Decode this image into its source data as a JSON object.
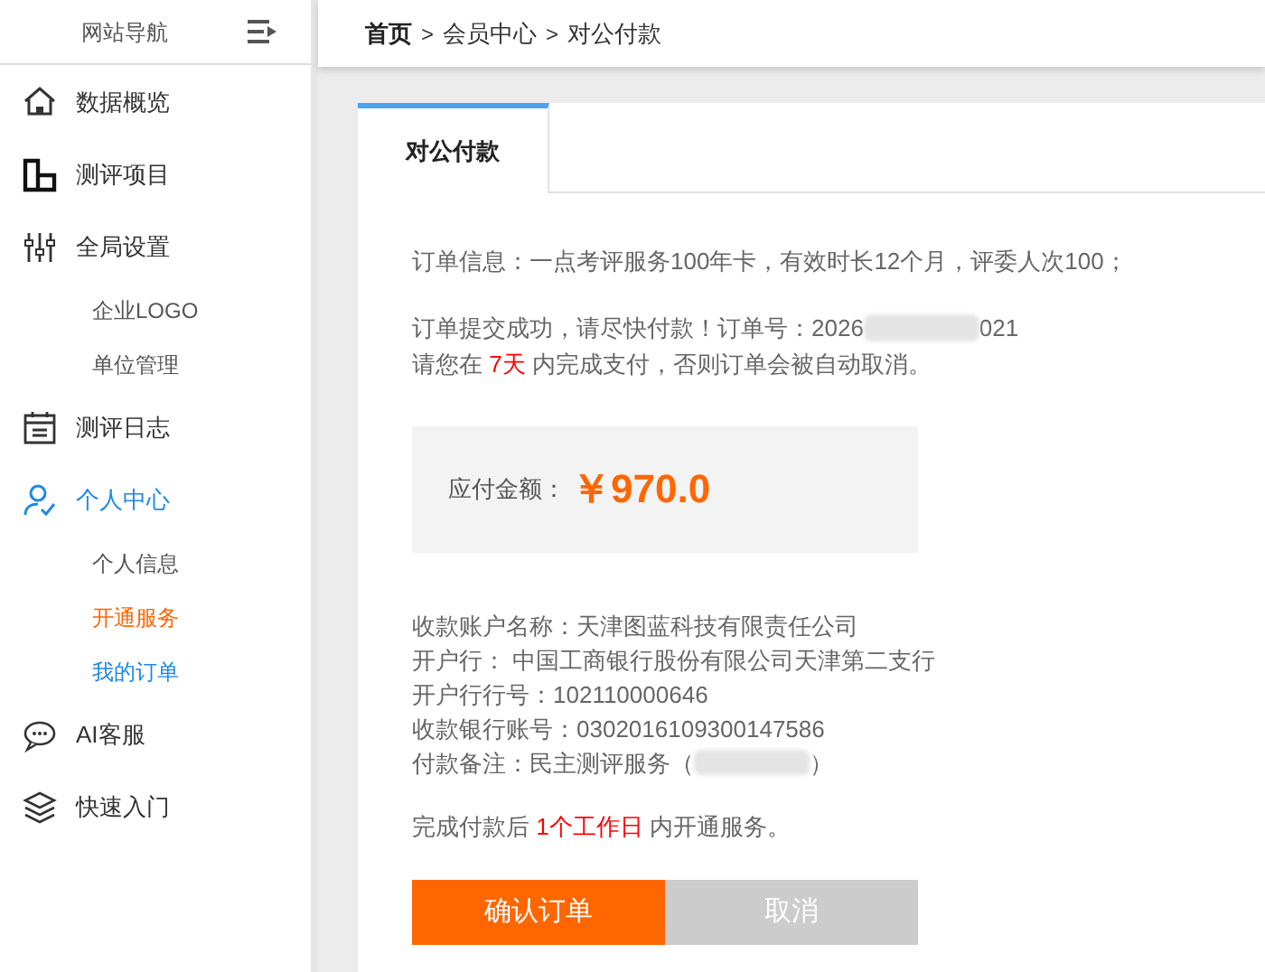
{
  "sidebar": {
    "title": "网站导航",
    "items": [
      {
        "label": "数据概览",
        "active": false
      },
      {
        "label": "测评项目",
        "active": false
      },
      {
        "label": "全局设置",
        "active": false,
        "children": [
          {
            "label": "企业LOGO",
            "kind": "normal"
          },
          {
            "label": "单位管理",
            "kind": "normal"
          }
        ]
      },
      {
        "label": "测评日志",
        "active": false
      },
      {
        "label": "个人中心",
        "active": true,
        "children": [
          {
            "label": "个人信息",
            "kind": "normal"
          },
          {
            "label": "开通服务",
            "kind": "selected"
          },
          {
            "label": "我的订单",
            "kind": "hovered"
          }
        ]
      },
      {
        "label": "AI客服",
        "active": false
      },
      {
        "label": "快速入门",
        "active": false
      }
    ]
  },
  "breadcrumb": [
    {
      "label": "首页",
      "kind": "root"
    },
    {
      "label": ">",
      "kind": "sep"
    },
    {
      "label": "会员中心",
      "kind": "link"
    },
    {
      "label": ">",
      "kind": "sep"
    },
    {
      "label": "对公付款",
      "kind": "link"
    }
  ],
  "tabs": [
    {
      "label": "对公付款",
      "selected": true
    }
  ],
  "order_info": "订单信息：一点考评服务100年卡，有效时长12个月，评委人次100；",
  "order_number": {
    "label": "订单提交成功，请尽快付款！订单号：",
    "start": "2026",
    "end": "021"
  },
  "deadline": {
    "before": "请您在",
    "highlight": "7天",
    "after": "内完成支付，否则订单会被自动取消。"
  },
  "amount": {
    "label": "应付金额：",
    "value": "￥970.0"
  },
  "bank_details": [
    {
      "kind": "text",
      "text": "收款账户名称：天津图蓝科技有限责任公司"
    },
    {
      "kind": "text",
      "text": "开户行：  中国工商银行股份有限公司天津第二支行"
    },
    {
      "kind": "text",
      "text": "开户行行号：102110000646"
    },
    {
      "kind": "text",
      "text": "收款银行账号：0302016109300147586"
    },
    {
      "kind": "redacted",
      "text": "付款备注：民主测评服务（",
      "end": "）"
    }
  ],
  "activation_note": {
    "before": "完成付款后",
    "highlight": "1个工作日",
    "after": "内开通服务。"
  },
  "buttons": [
    {
      "label": "确认订单",
      "kind": "primary"
    },
    {
      "label": "取消",
      "kind": "secondary"
    }
  ]
}
